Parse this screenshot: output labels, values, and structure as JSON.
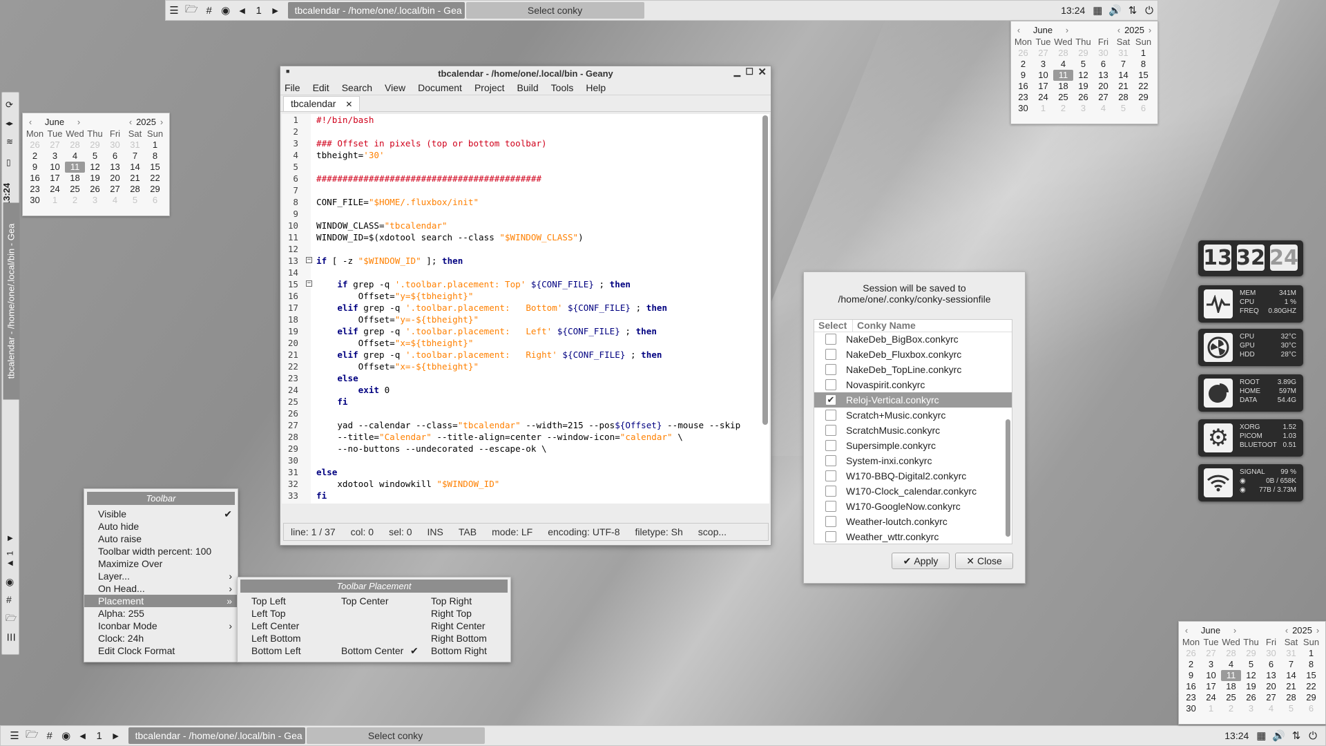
{
  "top_toolbar": {
    "workspace": "1",
    "task_active": "tbcalendar - /home/one/.local/bin - Gea",
    "task_other": "Select conky",
    "clock": "13:24"
  },
  "bottom_toolbar": {
    "workspace": "1",
    "task_active": "tbcalendar - /home/one/.local/bin - Gea",
    "task_other": "Select conky",
    "clock": "13:24"
  },
  "side_toolbar": {
    "clock": "13:24",
    "task": "tbcalendar - /home/one/.local/bin - Gea",
    "workspace": "1"
  },
  "calendar": {
    "month": "June",
    "year": "2025",
    "dows": [
      "Mon",
      "Tue",
      "Wed",
      "Thu",
      "Fri",
      "Sat",
      "Sun"
    ],
    "cells": [
      "26",
      "27",
      "28",
      "29",
      "30",
      "31",
      "1",
      "2",
      "3",
      "4",
      "5",
      "6",
      "7",
      "8",
      "9",
      "10",
      "11",
      "12",
      "13",
      "14",
      "15",
      "16",
      "17",
      "18",
      "19",
      "20",
      "21",
      "22",
      "23",
      "24",
      "25",
      "26",
      "27",
      "28",
      "29",
      "30",
      "1",
      "2",
      "3",
      "4",
      "5",
      "6"
    ],
    "selected": "11"
  },
  "geany": {
    "title": "tbcalendar - /home/one/.local/bin - Geany",
    "menus": [
      "File",
      "Edit",
      "Search",
      "View",
      "Document",
      "Project",
      "Build",
      "Tools",
      "Help"
    ],
    "tab": "tbcalendar",
    "status": {
      "line": "line: 1 / 37",
      "col": "col: 0",
      "sel": "sel: 0",
      "ins": "INS",
      "tab": "TAB",
      "mode": "mode: LF",
      "encoding": "encoding: UTF-8",
      "filetype": "filetype: Sh",
      "scope": "scop..."
    },
    "lines": [
      [
        "1",
        "#!/bin/bash"
      ],
      [
        "2",
        ""
      ],
      [
        "3",
        "### Offset in pixels (top or bottom toolbar)"
      ],
      [
        "4",
        "tbheight='30'"
      ],
      [
        "5",
        ""
      ],
      [
        "6",
        "###########################################"
      ],
      [
        "7",
        ""
      ],
      [
        "8",
        "CONF_FILE=\"$HOME/.fluxbox/init\""
      ],
      [
        "9",
        ""
      ],
      [
        "10",
        "WINDOW_CLASS=\"tbcalendar\""
      ],
      [
        "11",
        "WINDOW_ID=$(xdotool search --class \"$WINDOW_CLASS\")"
      ],
      [
        "12",
        ""
      ],
      [
        "13",
        "if [ -z \"$WINDOW_ID\" ]; then"
      ],
      [
        "14",
        ""
      ],
      [
        "15",
        "    if grep -q '.toolbar.placement: Top' ${CONF_FILE} ; then"
      ],
      [
        "16",
        "        Offset=\"y=${tbheight}\""
      ],
      [
        "17",
        "    elif grep -q '.toolbar.placement:   Bottom' ${CONF_FILE} ; then"
      ],
      [
        "18",
        "        Offset=\"y=-${tbheight}\""
      ],
      [
        "19",
        "    elif grep -q '.toolbar.placement:   Left' ${CONF_FILE} ; then"
      ],
      [
        "20",
        "        Offset=\"x=${tbheight}\""
      ],
      [
        "21",
        "    elif grep -q '.toolbar.placement:   Right' ${CONF_FILE} ; then"
      ],
      [
        "22",
        "        Offset=\"x=-${tbheight}\""
      ],
      [
        "23",
        "    else"
      ],
      [
        "24",
        "        exit 0"
      ],
      [
        "25",
        "    fi"
      ],
      [
        "26",
        ""
      ],
      [
        "27",
        "    yad --calendar --class=\"tbcalendar\" --width=215 --pos${Offset} --mouse --skip"
      ],
      [
        "28",
        "    --title=\"Calendar\" --title-align=center --window-icon=\"calendar\" \\"
      ],
      [
        "29",
        "    --no-buttons --undecorated --escape-ok \\"
      ],
      [
        "30",
        ""
      ],
      [
        "31",
        "else"
      ],
      [
        "32",
        "    xdotool windowkill \"$WINDOW_ID\""
      ],
      [
        "33",
        "fi"
      ]
    ]
  },
  "toolbar_menu": {
    "title": "Toolbar",
    "items": [
      "Visible",
      "Auto hide",
      "Auto raise",
      "Toolbar width percent:  100",
      "Maximize Over",
      "Layer...",
      "On Head...",
      "Placement",
      "Alpha:  255",
      "Iconbar Mode",
      "Clock: 24h",
      "Edit Clock Format"
    ]
  },
  "placement_menu": {
    "title": "Toolbar Placement",
    "col1": [
      "Top Left",
      "Left Top",
      "Left Center",
      "Left Bottom",
      "Bottom Left"
    ],
    "col2": [
      "Top Center",
      "",
      "",
      "",
      "Bottom Center"
    ],
    "col3": [
      "Top Right",
      "Right Top",
      "Right Center",
      "Right Bottom",
      "Bottom Right"
    ]
  },
  "session": {
    "line1": "Session will be saved to",
    "line2": "/home/one/.conky/conky-sessionfile",
    "col_select": "Select",
    "col_name": "Conky Name",
    "rows": [
      "NakeDeb_BigBox.conkyrc",
      "NakeDeb_Fluxbox.conkyrc",
      "NakeDeb_TopLine.conkyrc",
      "Novaspirit.conkyrc",
      "Reloj-Vertical.conkyrc",
      "Scratch+Music.conkyrc",
      "ScratchMusic.conkyrc",
      "Supersimple.conkyrc",
      "System-inxi.conkyrc",
      "W170-BBQ-Digital2.conkyrc",
      "W170-Clock_calendar.conkyrc",
      "W170-GoogleNow.conkyrc",
      "Weather-loutch.conkyrc",
      "Weather_wttr.conkyrc"
    ],
    "checked": "Reloj-Vertical.conkyrc",
    "apply": "Apply",
    "close": "Close"
  },
  "conky": {
    "h": "13",
    "m": "32",
    "s": "24",
    "mem": {
      "labels": [
        "MEM",
        "CPU",
        "FREQ"
      ],
      "values": [
        "341M",
        "1 %",
        "0.80GHZ"
      ]
    },
    "temp": {
      "labels": [
        "CPU",
        "GPU",
        "HDD"
      ],
      "values": [
        "32°C",
        "30°C",
        "28°C"
      ]
    },
    "disk": {
      "labels": [
        "ROOT",
        "HOME",
        "DATA"
      ],
      "values": [
        "3.89G",
        "597M",
        "54.4G"
      ]
    },
    "load": {
      "labels": [
        "XORG",
        "PICOM",
        "BLUETOOT"
      ],
      "values": [
        "1.52",
        "1.03",
        "0.51"
      ]
    },
    "net": {
      "labels": [
        "SIGNAL",
        "",
        ""
      ],
      "values": [
        "99 %",
        "0B / 658K",
        "77B / 3.73M"
      ]
    }
  }
}
